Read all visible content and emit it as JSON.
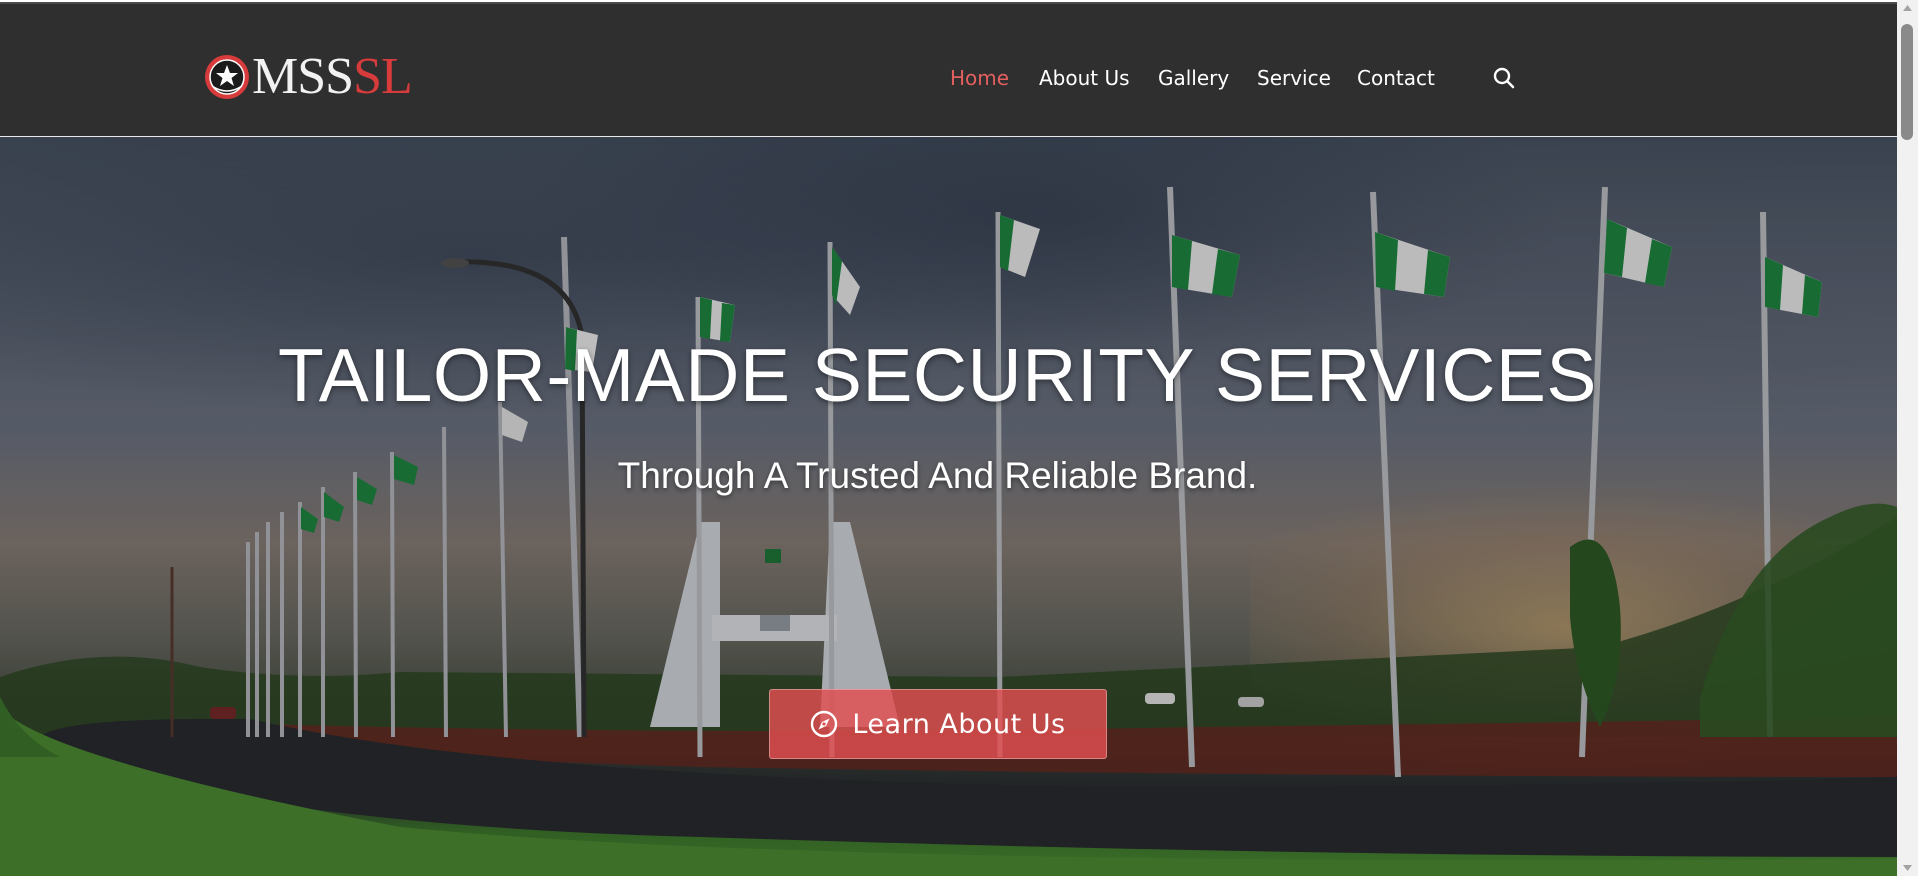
{
  "brand": {
    "name_white": "MSS",
    "name_red": "SL",
    "colors": {
      "primary_red": "#d83b3b",
      "nav_bg": "#2f2f2f",
      "active": "#e4605f"
    }
  },
  "nav": {
    "items": [
      {
        "label": "Home",
        "active": true
      },
      {
        "label": "About Us",
        "active": false
      },
      {
        "label": "Gallery",
        "active": false
      },
      {
        "label": "Service",
        "active": false
      },
      {
        "label": "Contact",
        "active": false
      }
    ],
    "search_icon": "search-icon"
  },
  "hero": {
    "title": "TAILOR-MADE SECURITY SERVICES",
    "subtitle": "Through A Trusted And Reliable Brand.",
    "cta_label": "Learn About Us",
    "cta_icon": "compass-icon"
  }
}
